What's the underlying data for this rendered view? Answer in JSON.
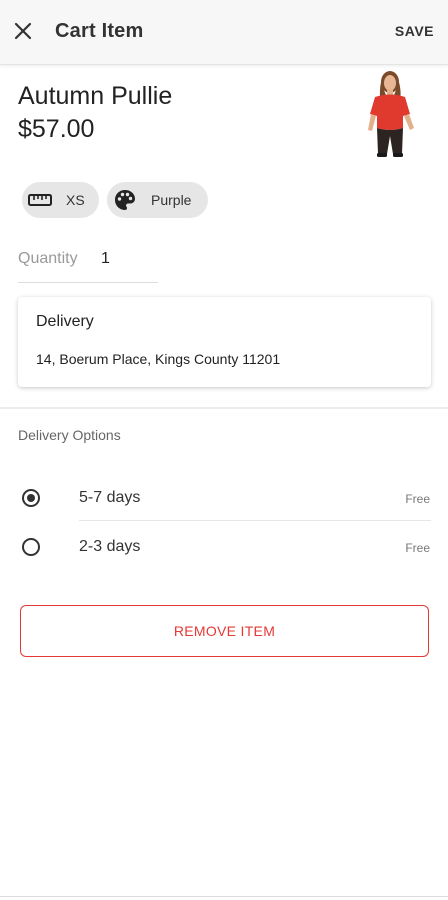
{
  "appbar": {
    "close_icon": "close-icon",
    "title": "Cart Item",
    "save_label": "SAVE"
  },
  "product": {
    "name": "Autumn Pullie",
    "price": "$57.00",
    "image_icon": "product-photo-red-top"
  },
  "attributes": {
    "size": {
      "icon": "ruler-icon",
      "label": "XS"
    },
    "color": {
      "icon": "palette-icon",
      "label": "Purple"
    }
  },
  "quantity": {
    "label": "Quantity",
    "value": "1"
  },
  "delivery": {
    "title": "Delivery",
    "address": "14, Boerum Place, Kings County 11201"
  },
  "delivery_options": {
    "header": "Delivery Options",
    "options": [
      {
        "label": "5-7 days",
        "price": "Free",
        "selected": true
      },
      {
        "label": "2-3 days",
        "price": "Free",
        "selected": false
      }
    ]
  },
  "actions": {
    "remove_label": "REMOVE ITEM"
  },
  "colors": {
    "accent": "#e53935",
    "appbar_bg": "#f7f7f7",
    "chip_bg": "#e6e6e6",
    "product_red": "#e03a2f"
  }
}
